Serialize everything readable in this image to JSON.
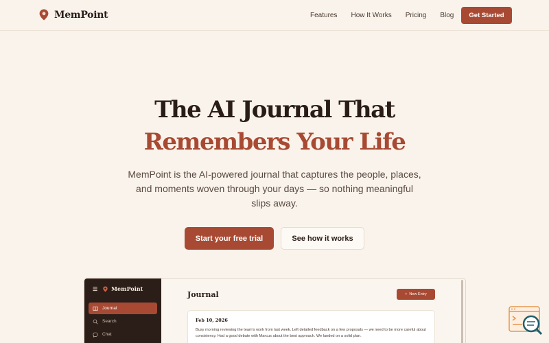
{
  "nav": {
    "brand": "MemPoint",
    "links": [
      "Features",
      "How It Works",
      "Pricing",
      "Blog"
    ],
    "cta": "Get Started"
  },
  "hero": {
    "title_line1": "The AI Journal That",
    "title_line2": "Remembers Your Life",
    "subtitle": "MemPoint is the AI-powered journal that captures the people, places, and moments woven through your days — so nothing meaningful slips away.",
    "primary_cta": "Start your free trial",
    "secondary_cta": "See how it works"
  },
  "app_preview": {
    "brand": "MemPoint",
    "sidebar": [
      {
        "label": "Journal",
        "icon": "book-icon",
        "active": true
      },
      {
        "label": "Search",
        "icon": "search-icon",
        "active": false
      },
      {
        "label": "Chat",
        "icon": "chat-icon",
        "active": false
      }
    ],
    "page_title": "Journal",
    "new_entry_label": "New Entry",
    "entry": {
      "date": "Feb 10, 2026",
      "text": "Busy morning reviewing the team's work from last week. Left detailed feedback on a few proposals — we need to be more careful about consistency. Had a good debate with Marcus about the best approach. We landed on a solid plan."
    }
  },
  "colors": {
    "accent": "#a84a33",
    "background": "#f9f3eb",
    "sidebar": "#2b1e18"
  }
}
